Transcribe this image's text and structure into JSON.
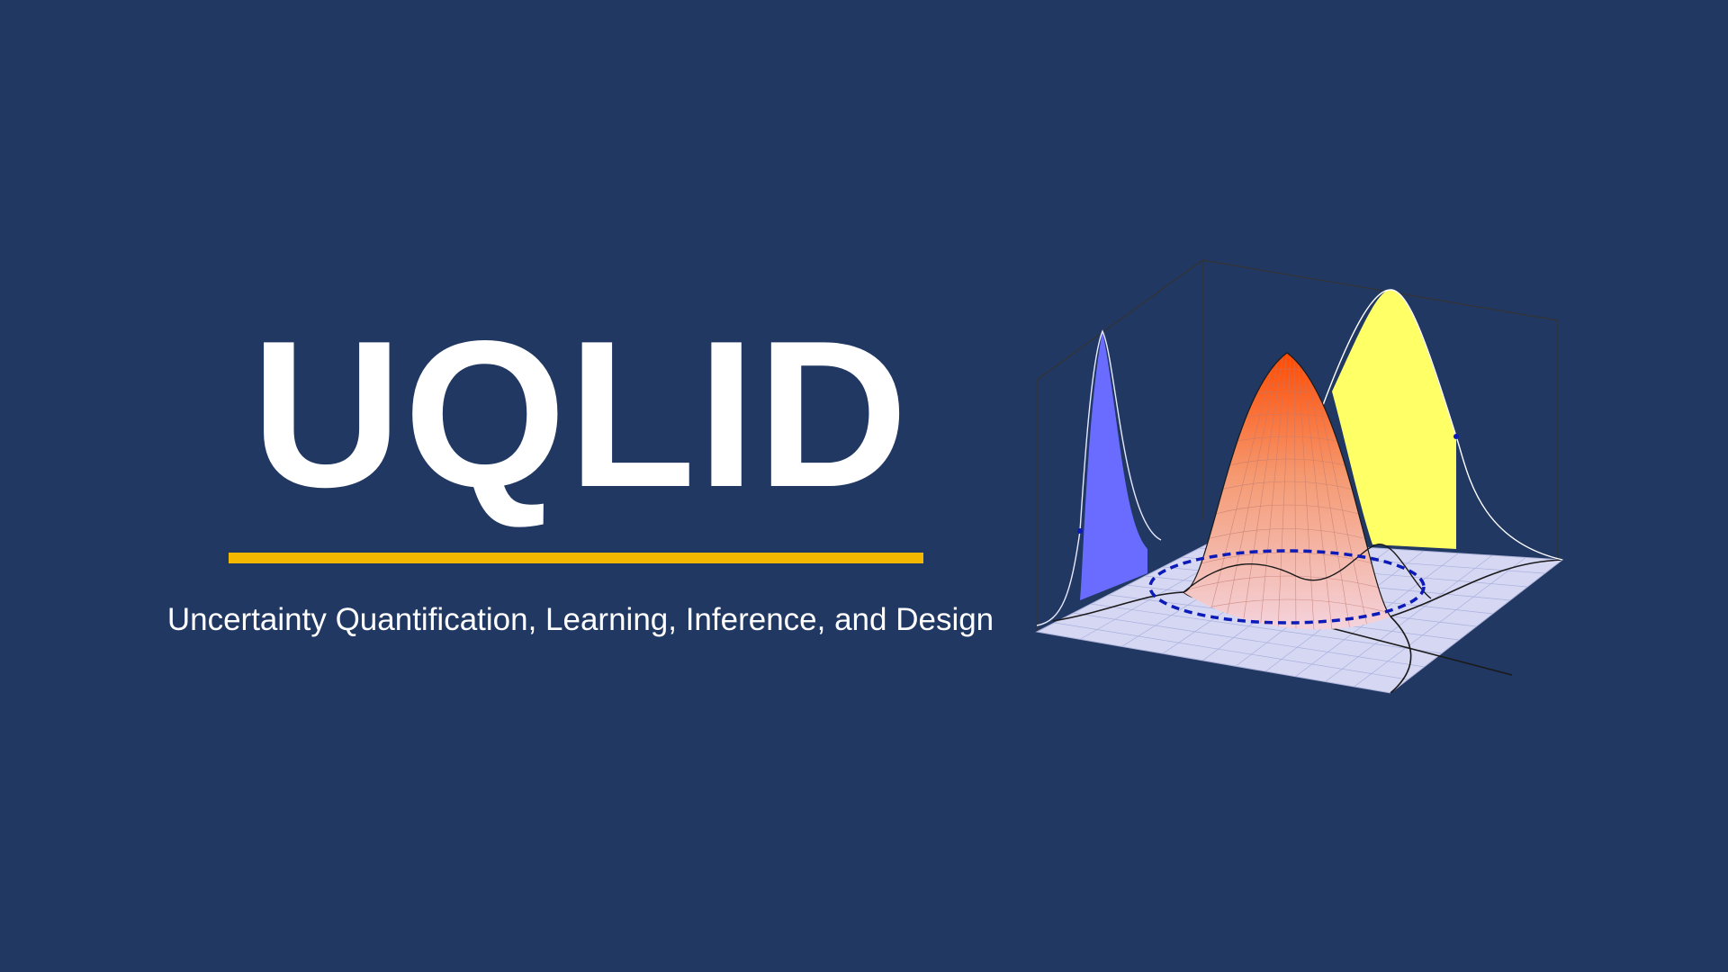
{
  "header": {
    "title": "UQLID",
    "subtitle": "Uncertainty Quantification, Learning, Inference, and Design"
  },
  "colors": {
    "background": "#213863",
    "accent": "#f5b800",
    "text": "#ffffff",
    "marginal_left": "#6a6cff",
    "marginal_right": "#ffff66",
    "peak_top": "#ff4a00",
    "peak_base": "#f2c8d4",
    "plane": "#d6d8f3",
    "contour": "#0c1bb8"
  },
  "graphic": {
    "icon": "bivariate-gaussian-distribution-illustration"
  }
}
